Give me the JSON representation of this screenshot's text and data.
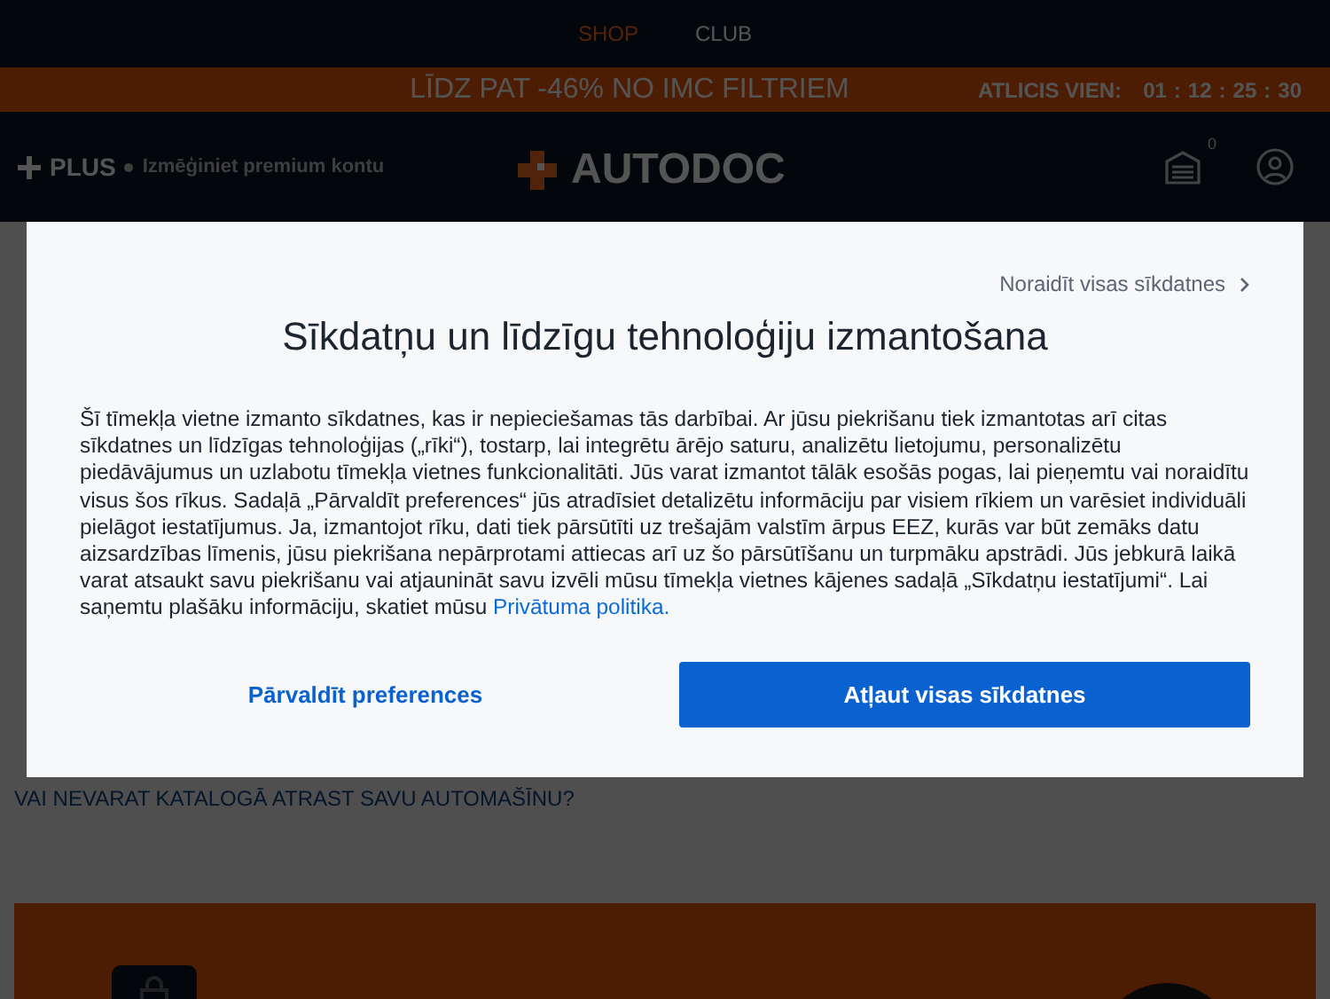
{
  "top_nav": [
    {
      "label": "SHOP",
      "selected": true
    },
    {
      "label": "CLUB",
      "selected": false
    }
  ],
  "promo": {
    "text": "LĪDZ PAT -46% NO IMC FILTRIEM",
    "timer_label": "ATLICIS VIEN:",
    "timer_parts": [
      "01",
      "12",
      "25",
      "30"
    ],
    "separator": ":"
  },
  "header": {
    "plus_label": "PLUS",
    "plus_tagline": "Izmēģiniet premium kontu",
    "logo": "AUTODOC",
    "cart_count": "0"
  },
  "cookie_dialog": {
    "reject_link": "Noraidīt visas sīkdatnes",
    "title": "Sīkdatņu un līdzīgu tehnoloģiju izmantošana",
    "body": "Šī tīmekļa vietne izmanto sīkdatnes, kas ir nepieciešamas tās darbībai. Ar jūsu piekrišanu tiek izmantotas arī citas sīkdatnes un līdzīgas tehnoloģijas („rīki“), tostarp, lai integrētu ārējo saturu, analizētu lietojumu, personalizētu piedāvājumus un uzlabotu tīmekļa vietnes funkcionalitāti. Jūs varat izmantot tālāk esošās pogas, lai pieņemtu vai noraidītu visus šos rīkus. Sadaļā „Pārvaldīt preferences“ jūs atradīsiet detalizētu informāciju par visiem rīkiem un varēsiet individuāli pielāgot iestatījumus. Ja, izmantojot rīku, dati tiek pārsūtīti uz trešajām valstīm ārpus EEZ, kurās var būt zemāks datu aizsardzības līmenis, jūsu piekrišana nepārprotami attiecas arī uz šo pārsūtīšanu un turpmāku apstrādi. Jūs jebkurā laikā varat atsaukt savu piekrišanu vai atjaunināt savu izvēli mūsu tīmekļa vietnes kājenes sadaļā „Sīkdatņu iestatījumi“. Lai saņemtu plašāku informāciju, skatiet mūsu",
    "privacy_link": "Privātuma politika.",
    "manage_button": "Pārvaldīt preferences",
    "accept_button": "Atļaut visas sīkdatnes"
  },
  "page": {
    "catalog_link": "VAI NEVARAT KATALOGĀ ATRAST SAVU AUTOMAŠĪNU?"
  }
}
